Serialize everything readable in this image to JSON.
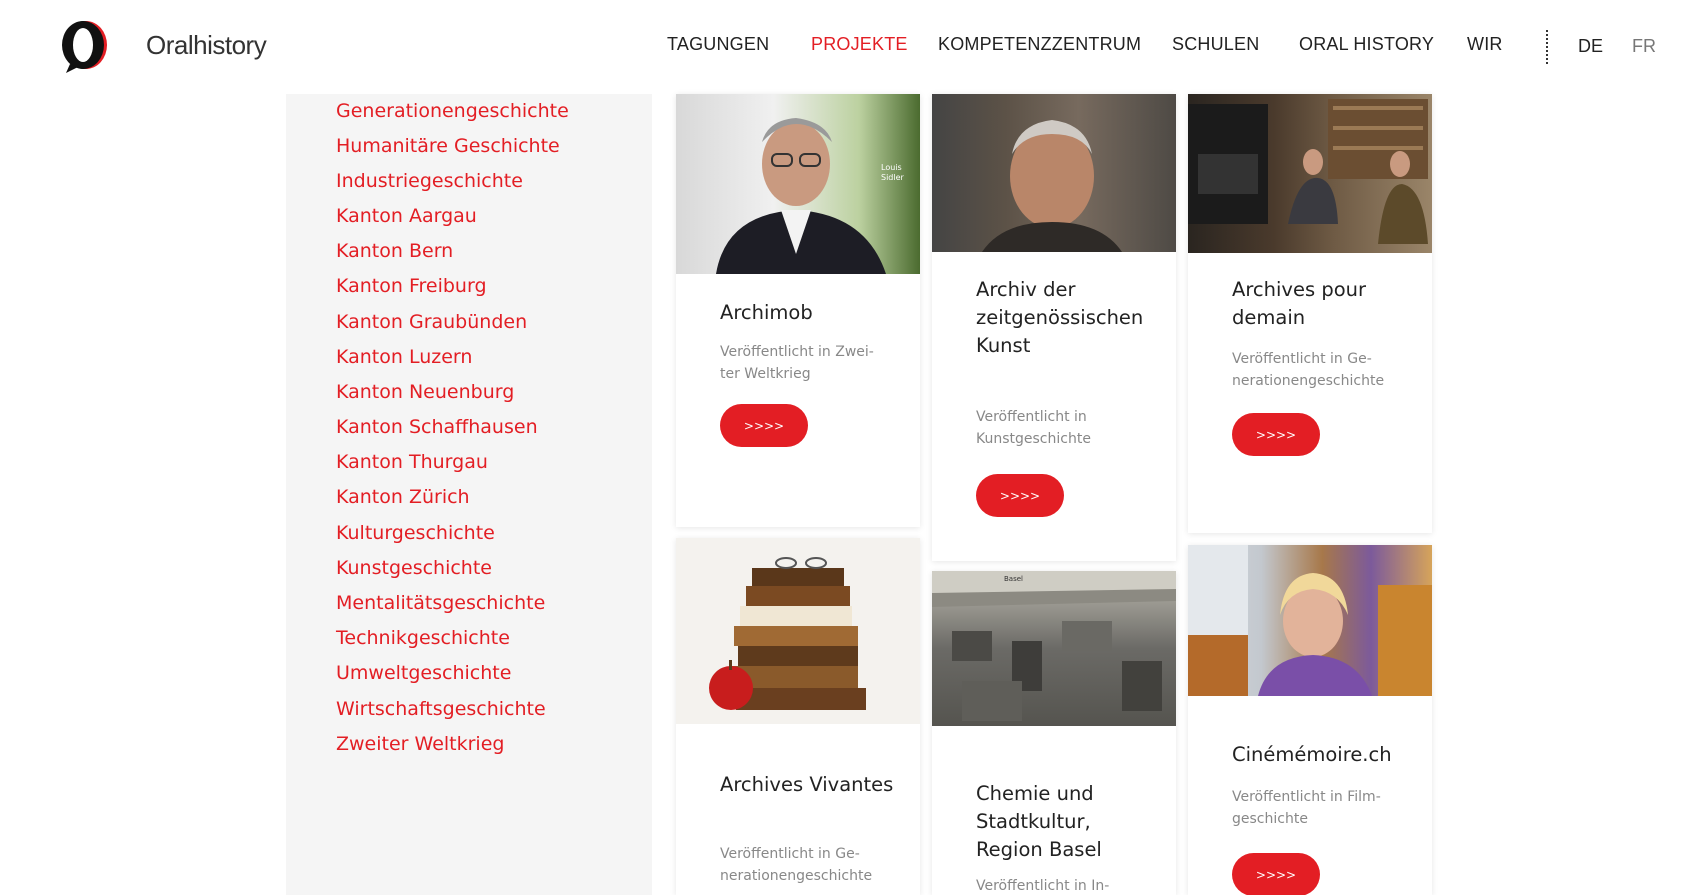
{
  "header": {
    "brand": "Oralhistory",
    "nav": [
      {
        "label": "TAGUNGEN",
        "active": false
      },
      {
        "label": "PROJEKTE",
        "active": true
      },
      {
        "label": "KOMPETENZZENTRUM",
        "active": false
      },
      {
        "label": "SCHULEN",
        "active": false
      },
      {
        "label": "ORAL HISTORY",
        "active": false
      },
      {
        "label": "WIR",
        "active": false
      }
    ],
    "languages": [
      "DE",
      "FR"
    ],
    "accent_color": "#e31e24"
  },
  "sidebar": {
    "categories": [
      "Generationengeschichte",
      "Humanitäre Geschichte",
      "Industriegeschichte",
      "Kanton Aargau",
      "Kanton Bern",
      "Kanton Freiburg",
      "Kanton Graubünden",
      "Kanton Luzern",
      "Kanton Neuenburg",
      "Kanton Schaffhausen",
      "Kanton Thurgau",
      "Kanton Zürich",
      "Kulturgeschichte",
      "Kunstgeschichte",
      "Mentalitätsgeschichte",
      "Technikgeschichte",
      "Umweltgeschichte",
      "Wirtschaftsgeschichte",
      "Zweiter Weltkrieg"
    ]
  },
  "cards": [
    {
      "title": "Archimob",
      "meta": "Veröffentlicht in Zwei-\nter Weltkrieg",
      "button": ">>>>",
      "image_caption": "Louis\nSidler"
    },
    {
      "title": "Archiv der zeitgenössischen Kunst",
      "meta": "Veröffentlicht in\nKunstgeschichte",
      "button": ">>>>"
    },
    {
      "title": "Archives pour demain",
      "meta": "Veröffentlicht in Ge-\nnerationengeschichte",
      "button": ">>>>"
    },
    {
      "title": "Archives Vivantes",
      "meta": "Veröffentlicht in Ge-\nnerationengeschichte",
      "button": ">>>>"
    },
    {
      "title": "Chemie und Stadtkultur, Region Basel",
      "meta": "Veröffentlicht in In-",
      "button": ">>>>",
      "image_caption": "Basel"
    },
    {
      "title": "Cinémémoire.ch",
      "meta": "Veröffentlicht in Film-\ngeschichte",
      "button": ">>>>"
    }
  ]
}
